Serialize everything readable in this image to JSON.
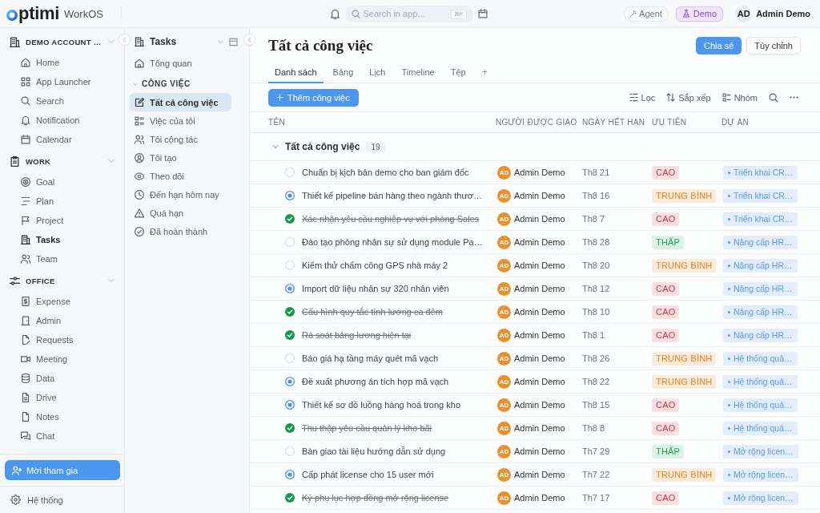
{
  "topbar": {
    "brand": "ptimi",
    "product": "WorkOS",
    "search": {
      "placeholder": "Search in app...",
      "shortcut": "⌘K"
    },
    "agent": "Agent",
    "demo": "Demo",
    "user": {
      "initials": "AD",
      "name": "Admin Demo"
    }
  },
  "sidebar": {
    "sections": [
      {
        "title": "DEMO ACCOUNT …",
        "expanded": true,
        "items": [
          {
            "label": "Home",
            "selected": false
          },
          {
            "label": "App Launcher",
            "selected": false
          },
          {
            "label": "Search",
            "selected": false
          },
          {
            "label": "Notification",
            "selected": false
          },
          {
            "label": "Calendar",
            "selected": false
          }
        ]
      },
      {
        "title": "WORK",
        "expanded": true,
        "items": [
          {
            "label": "Goal",
            "selected": false
          },
          {
            "label": "Plan",
            "selected": false
          },
          {
            "label": "Project",
            "selected": false
          },
          {
            "label": "Tasks",
            "selected": true
          },
          {
            "label": "Team",
            "selected": false
          }
        ]
      },
      {
        "title": "OFFICE",
        "expanded": true,
        "items": [
          {
            "label": "Expense",
            "selected": false
          },
          {
            "label": "Admin",
            "selected": false
          },
          {
            "label": "Requests",
            "selected": false
          },
          {
            "label": "Meeting",
            "selected": false
          },
          {
            "label": "Data",
            "selected": false
          },
          {
            "label": "Drive",
            "selected": false
          },
          {
            "label": "Notes",
            "selected": false
          },
          {
            "label": "Chat",
            "selected": false
          }
        ]
      }
    ],
    "invite_button": "Mời tham gia",
    "settings": "Hệ thống"
  },
  "subnav": {
    "title": "Tasks",
    "items": [
      {
        "label": "Tổng quan",
        "selected": false
      }
    ],
    "groups": [
      {
        "title": "CÔNG VIỆC",
        "expanded": true,
        "items": [
          {
            "label": "Tất cả công việc",
            "selected": true
          },
          {
            "label": "Việc của tôi",
            "selected": false
          },
          {
            "label": "Tôi cộng tác",
            "selected": false
          },
          {
            "label": "Tôi tạo",
            "selected": false
          },
          {
            "label": "Theo dõi",
            "selected": false
          },
          {
            "label": "Đến hạn hôm nay",
            "selected": false
          },
          {
            "label": "Quá hạn",
            "selected": false
          },
          {
            "label": "Đã hoàn thành",
            "selected": false
          }
        ]
      }
    ]
  },
  "page": {
    "title": "Tất cả công việc",
    "actions": [
      {
        "label": "Chia sẻ",
        "kind": "primary"
      },
      {
        "label": "Tùy chỉnh",
        "kind": "secondary"
      }
    ],
    "tabs": [
      {
        "label": "Danh sách",
        "selected": true
      },
      {
        "label": "Bảng",
        "selected": false
      },
      {
        "label": "Lịch",
        "selected": false
      },
      {
        "label": "Timeline",
        "selected": false
      },
      {
        "label": "Tệp",
        "selected": false
      }
    ],
    "add_tab": "+",
    "add_button": "Thêm công việc",
    "tools": [
      "Lọc",
      "Sắp xếp",
      "Nhóm"
    ]
  },
  "table": {
    "columns": [
      "TÊN",
      "NGƯỜI ĐƯỢC GIAO",
      "NGÀY HẾT HẠN",
      "ƯU TIÊN",
      "DỰ ÁN"
    ],
    "group": {
      "title": "Tất cả công việc",
      "count": "19",
      "expanded": true
    },
    "rows": [
      {
        "kind": "todo",
        "name": "Chuẩn bị kịch bản demo cho ban giám đốc",
        "assignee_initials": "AD",
        "assignee": "Admin Demo",
        "due": "Th8 21",
        "priority": {
          "label": "CAO",
          "kind": "high"
        },
        "project": "Triển khai CR…"
      },
      {
        "kind": "in_progress",
        "name": "Thiết kế pipeline bán hàng theo ngành thươ…",
        "assignee_initials": "AD",
        "assignee": "Admin Demo",
        "due": "Th8 16",
        "priority": {
          "label": "TRUNG BÌNH",
          "kind": "medium"
        },
        "project": "Triển khai CR…"
      },
      {
        "kind": "done",
        "name": "Xác nhận yêu cầu nghiệp vụ với phòng Sales",
        "assignee_initials": "AD",
        "assignee": "Admin Demo",
        "due": "Th8 7",
        "priority": {
          "label": "CAO",
          "kind": "high"
        },
        "project": "Triển khai CR…"
      },
      {
        "kind": "todo",
        "name": "Đào tạo phòng nhân sự sử dụng module Pa…",
        "assignee_initials": "AD",
        "assignee": "Admin Demo",
        "due": "Th8 28",
        "priority": {
          "label": "THẤP",
          "kind": "low"
        },
        "project": "Nâng cấp HR…"
      },
      {
        "kind": "todo",
        "name": "Kiểm thử chấm công GPS nhà máy 2",
        "assignee_initials": "AD",
        "assignee": "Admin Demo",
        "due": "Th8 20",
        "priority": {
          "label": "TRUNG BÌNH",
          "kind": "medium"
        },
        "project": "Nâng cấp HR…"
      },
      {
        "kind": "in_progress",
        "name": "Import dữ liệu nhân sự 320 nhân viên",
        "assignee_initials": "AD",
        "assignee": "Admin Demo",
        "due": "Th8 12",
        "priority": {
          "label": "CAO",
          "kind": "high"
        },
        "project": "Nâng cấp HR…"
      },
      {
        "kind": "done",
        "name": "Cấu hình quy tắc tính lương ca đêm",
        "assignee_initials": "AD",
        "assignee": "Admin Demo",
        "due": "Th8 10",
        "priority": {
          "label": "CAO",
          "kind": "high"
        },
        "project": "Nâng cấp HR…"
      },
      {
        "kind": "done",
        "name": "Rà soát bảng lương hiện tại",
        "assignee_initials": "AD",
        "assignee": "Admin Demo",
        "due": "Th8 1",
        "priority": {
          "label": "CAO",
          "kind": "high"
        },
        "project": "Nâng cấp HR…"
      },
      {
        "kind": "todo",
        "name": "Báo giá hạ tầng máy quét mã vạch",
        "assignee_initials": "AD",
        "assignee": "Admin Demo",
        "due": "Th8 26",
        "priority": {
          "label": "TRUNG BÌNH",
          "kind": "medium"
        },
        "project": "Hệ thống quả…"
      },
      {
        "kind": "in_progress",
        "name": "Đề xuất phương án tích hợp mã vạch",
        "assignee_initials": "AD",
        "assignee": "Admin Demo",
        "due": "Th8 22",
        "priority": {
          "label": "TRUNG BÌNH",
          "kind": "medium"
        },
        "project": "Hệ thống quả…"
      },
      {
        "kind": "in_progress",
        "name": "Thiết kế sơ đồ luồng hàng hoá trong kho",
        "assignee_initials": "AD",
        "assignee": "Admin Demo",
        "due": "Th8 15",
        "priority": {
          "label": "CAO",
          "kind": "high"
        },
        "project": "Hệ thống quả…"
      },
      {
        "kind": "done",
        "name": "Thu thập yêu cầu quản lý kho bãi",
        "assignee_initials": "AD",
        "assignee": "Admin Demo",
        "due": "Th8 8",
        "priority": {
          "label": "CAO",
          "kind": "high"
        },
        "project": "Hệ thống quả…"
      },
      {
        "kind": "todo",
        "name": "Bàn giao tài liệu hướng dẫn sử dụng",
        "assignee_initials": "AD",
        "assignee": "Admin Demo",
        "due": "Th7 29",
        "priority": {
          "label": "THẤP",
          "kind": "low"
        },
        "project": "Mở rộng licen…"
      },
      {
        "kind": "in_progress",
        "name": "Cấp phát license cho 15 user mới",
        "assignee_initials": "AD",
        "assignee": "Admin Demo",
        "due": "Th7 22",
        "priority": {
          "label": "TRUNG BÌNH",
          "kind": "medium"
        },
        "project": "Mở rộng licen…"
      },
      {
        "kind": "done",
        "name": "Ký phụ lục hợp đồng mở rộng license",
        "assignee_initials": "AD",
        "assignee": "Admin Demo",
        "due": "Th7 17",
        "priority": {
          "label": "CAO",
          "kind": "high"
        },
        "project": "Mở rộng licen…"
      }
    ]
  }
}
